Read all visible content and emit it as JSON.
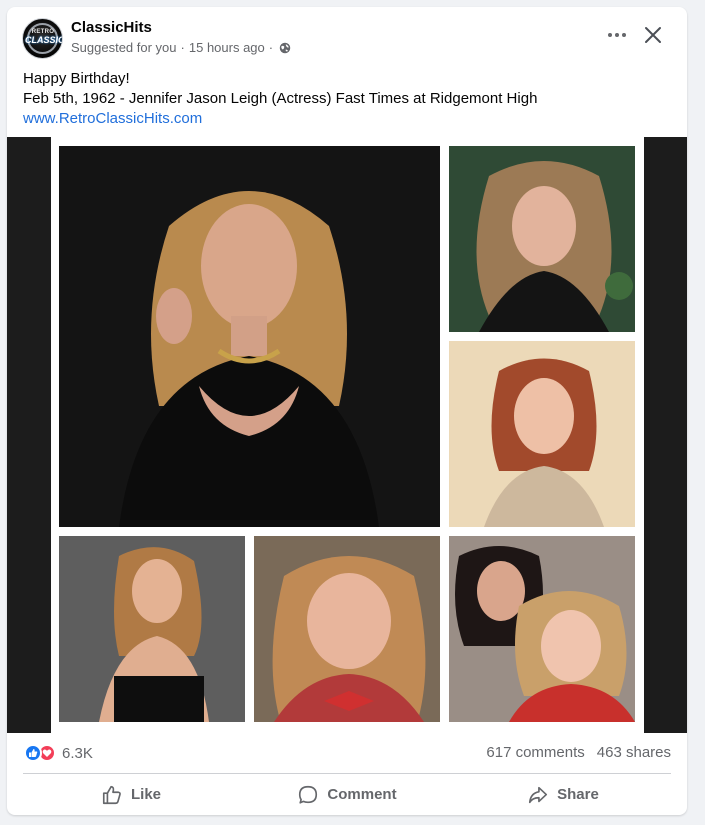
{
  "post": {
    "page_name": "ClassicHits",
    "avatar_logo_line1": "RETRO",
    "avatar_logo_line2": "CLASSIC",
    "suggestion": "Suggested for you",
    "separator": "·",
    "time": "15 hours ago",
    "audience_icon": "globe-icon",
    "more_icon": "more-horizontal-icon",
    "close_icon": "close-icon",
    "text_line1": "Happy Birthday!",
    "text_line2": "Feb 5th, 1962 - Jennifer Jason Leigh (Actress)  Fast Times at Ridgemont High",
    "link": "www.RetroClassicHits.com"
  },
  "media": {
    "photos": [
      {
        "name": "main-portrait-photo"
      },
      {
        "name": "young-portrait-photo"
      },
      {
        "name": "red-hair-portrait-photo"
      },
      {
        "name": "strapless-dress-photo"
      },
      {
        "name": "smiling-movie-still-photo"
      },
      {
        "name": "two-women-movie-still-photo"
      }
    ]
  },
  "engagement": {
    "reaction_icons": [
      "like-reaction-icon",
      "love-reaction-icon"
    ],
    "reaction_count": "6.3K",
    "comments": "617 comments",
    "shares": "463 shares"
  },
  "actions": {
    "like_label": "Like",
    "comment_label": "Comment",
    "share_label": "Share"
  },
  "colors": {
    "link": "#216fdb",
    "like": "#1877f2",
    "love": "#f33e58",
    "secondary_text": "#65676b"
  }
}
